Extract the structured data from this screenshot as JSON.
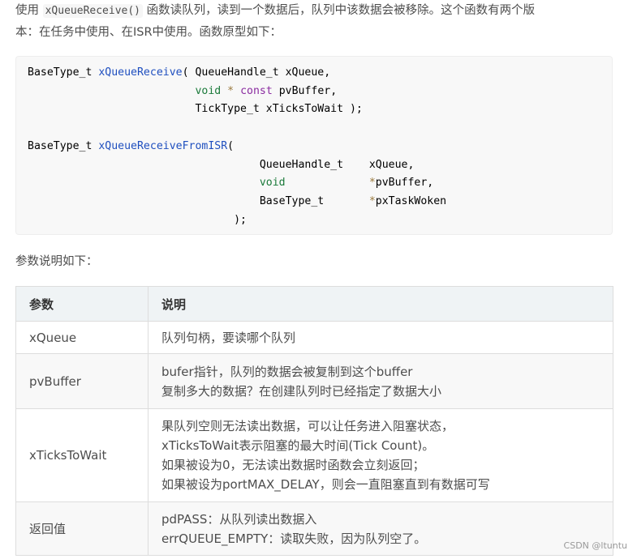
{
  "intro": {
    "line1_prefix": "使用",
    "function_name": "xQueueReceive()",
    "line1_suffix": "函数读队列，读到一个数据后，队列中该数据会被移除。这个函数有两个版",
    "line2": "本：在任务中使用、在ISR中使用。函数原型如下："
  },
  "code": {
    "proto1": {
      "ret": "BaseType_t",
      "fn": "xQueueReceive",
      "p1": "( QueueHandle_t xQueue,",
      "p2_kw": "void",
      "p2_op": "*",
      "p2_kw2": "const",
      "p2_rest": "pvBuffer,",
      "p3": "TickType_t xTicksToWait );"
    },
    "proto2": {
      "ret": "BaseType_t",
      "fn": "xQueueReceiveFromISR",
      "open": "(",
      "a1_type": "QueueHandle_t",
      "a1_name": "xQueue,",
      "a2_type": "void",
      "a2_op": "*",
      "a2_name": "pvBuffer,",
      "a3_type": "BaseType_t",
      "a3_op": "*",
      "a3_name": "pxTaskWoken",
      "close": ");"
    }
  },
  "subhead": "参数说明如下：",
  "table": {
    "headers": [
      "参数",
      "说明"
    ],
    "rows": [
      {
        "param": "xQueue",
        "desc": [
          "队列句柄，要读哪个队列"
        ]
      },
      {
        "param": "pvBuffer",
        "desc": [
          "bufer指针，队列的数据会被复制到这个buffer",
          "复制多大的数据？在创建队列时已经指定了数据大小"
        ]
      },
      {
        "param": "xTicksToWait",
        "desc": [
          "果队列空则无法读出数据，可以让任务进入阻塞状态，",
          "xTicksToWait表示阻塞的最大时间(Tick Count)。",
          "如果被设为0，无法读出数据时函数会立刻返回；",
          "如果被设为portMAX_DELAY，则会一直阻塞直到有数据可写"
        ]
      },
      {
        "param": "返回值",
        "desc": [
          "pdPASS：从队列读出数据入",
          "errQUEUE_EMPTY：读取失败，因为队列空了。"
        ]
      }
    ]
  },
  "watermark": "CSDN @ltuntu"
}
